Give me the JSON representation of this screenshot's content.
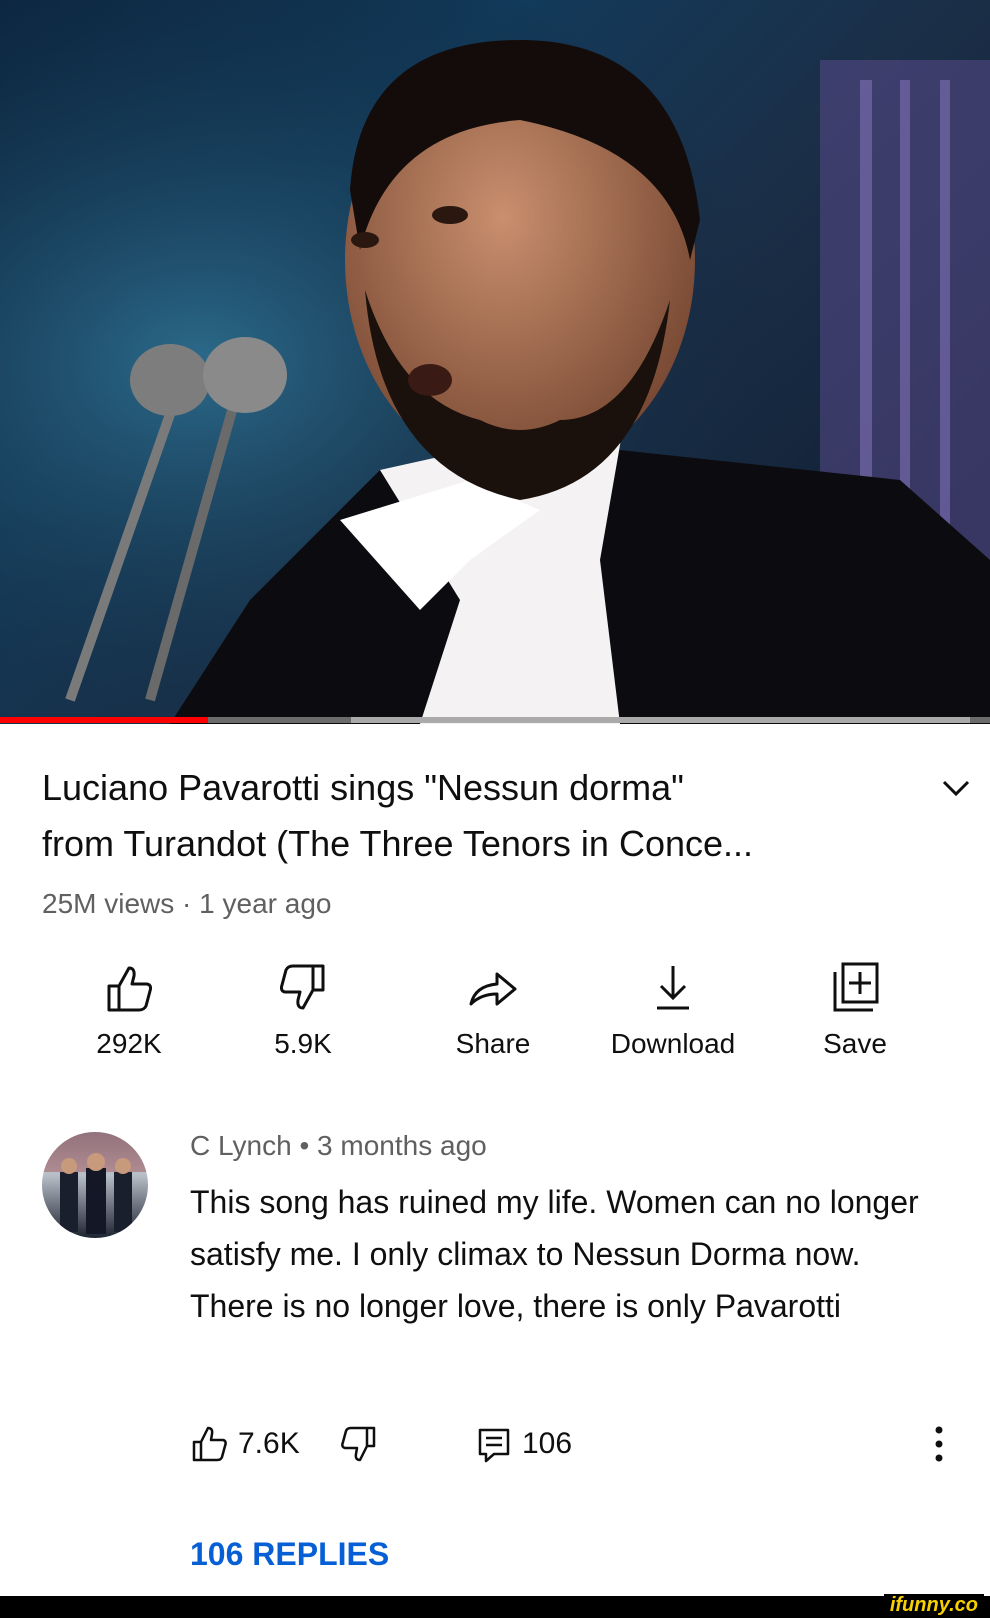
{
  "video": {
    "progress_fraction": 0.21,
    "buffered_fraction": 0.98
  },
  "details": {
    "title_line1": "Luciano Pavarotti sings \"Nessun dorma\"",
    "title_line2": "from Turandot (The Three Tenors in Conce...",
    "meta": "25M views · 1 year ago",
    "expand_icon": "chevron-down-icon"
  },
  "actions": [
    {
      "icon": "thumbs-up-icon",
      "label": "292K"
    },
    {
      "icon": "thumbs-down-icon",
      "label": "5.9K"
    },
    {
      "icon": "share-icon",
      "label": "Share"
    },
    {
      "icon": "download-icon",
      "label": "Download"
    },
    {
      "icon": "save-playlist-icon",
      "label": "Save"
    }
  ],
  "comment": {
    "author": "C Lynch",
    "age": "3 months ago",
    "author_line": "C Lynch • 3 months ago",
    "text": "This song has ruined my life. Women can no longer satisfy me. I only climax to Nessun Dorma now. There is no longer love, there is only Pavarotti",
    "likes": "7.6K",
    "reply_count": "106",
    "replies_link": "106 REPLIES"
  },
  "watermark": "ifunny.co",
  "colors": {
    "progress": "#ff0000",
    "link": "#065fd4",
    "secondary_text": "#606060",
    "watermark": "#f6d000"
  }
}
